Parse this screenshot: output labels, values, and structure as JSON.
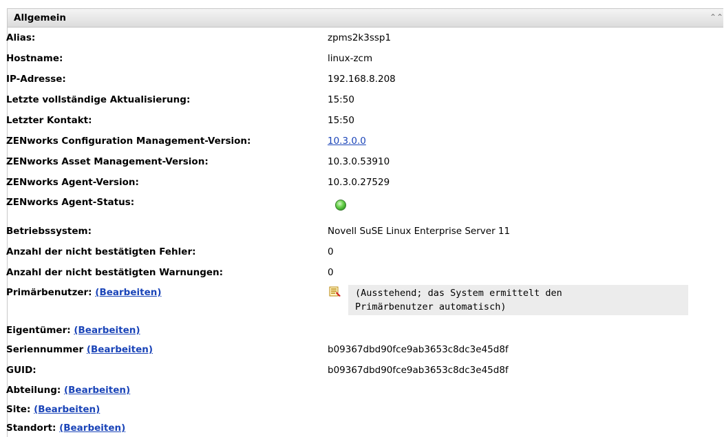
{
  "panel": {
    "title": "Allgemein"
  },
  "rows": [
    {
      "label": "Alias:",
      "value": "zpms2k3ssp1"
    },
    {
      "label": "Hostname:",
      "value": "linux-zcm"
    },
    {
      "label": "IP-Adresse:",
      "value": "192.168.8.208"
    },
    {
      "label": "Letzte vollständige Aktualisierung:",
      "value": "15:50"
    },
    {
      "label": "Letzter Kontakt:",
      "value": "15:50"
    },
    {
      "label": "ZENworks Configuration Management-Version:",
      "value": "10.3.0.0"
    },
    {
      "label": "ZENworks Asset Management-Version:",
      "value": "10.3.0.53910"
    },
    {
      "label": "ZENworks Agent-Version:",
      "value": "10.3.0.27529"
    },
    {
      "label": "ZENworks Agent-Status:",
      "status_icon": "green-status-icon"
    },
    {
      "label": "Betriebssystem:",
      "value": "Novell SuSE Linux Enterprise Server 11"
    },
    {
      "label": "Anzahl der nicht bestätigten Fehler:",
      "value": "0"
    },
    {
      "label": "Anzahl der nicht bestätigten Warnungen:",
      "value": "0"
    },
    {
      "label": "Primärbenutzer:",
      "edit": "(Bearbeiten)",
      "value": "(Ausstehend; das System ermittelt den\nPrimärbenutzer automatisch)"
    },
    {
      "label": "Eigentümer:",
      "edit": "(Bearbeiten)"
    },
    {
      "label": "Seriennummer",
      "edit": "(Bearbeiten)",
      "value": "b09367dbd90fce9ab3653c8dc3e45d8f"
    },
    {
      "label": "GUID:",
      "value": "b09367dbd90fce9ab3653c8dc3e45d8f"
    },
    {
      "label": "Abteilung:",
      "edit": "(Bearbeiten)"
    },
    {
      "label": "Site:",
      "edit": "(Bearbeiten)"
    },
    {
      "label": "Standort:",
      "edit": "(Bearbeiten)"
    }
  ]
}
